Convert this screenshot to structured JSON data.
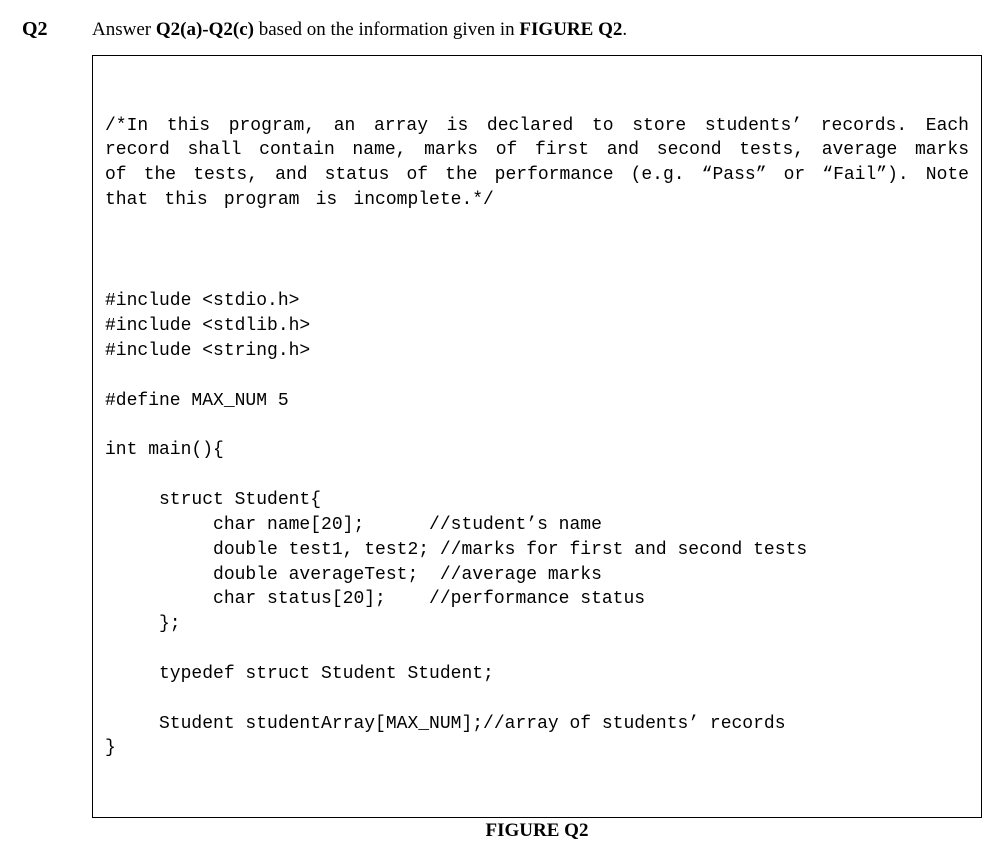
{
  "question": {
    "number": "Q2",
    "prompt_prefix": "Answer ",
    "prompt_bold1": "Q2(a)-Q2(c)",
    "prompt_mid": " based on the information given in  ",
    "prompt_bold2": "FIGURE Q2",
    "prompt_suffix": "."
  },
  "code": {
    "comment": "/*In this program, an array is declared to store students’ records. Each record shall contain name, marks of first and second tests, average marks of the tests, and status of the performance (e.g. “Pass” or “Fail”). Note that this program is incomplete.*/",
    "lines": [
      "",
      "#include <stdio.h>",
      "#include <stdlib.h>",
      "#include <string.h>",
      "",
      "#define MAX_NUM 5",
      "",
      "int main(){",
      "",
      "     struct Student{",
      "          char name[20];      //student’s name",
      "          double test1, test2; //marks for first and second tests",
      "          double averageTest;  //average marks",
      "          char status[20];    //performance status",
      "     };",
      "",
      "     typedef struct Student Student;",
      "",
      "     Student studentArray[MAX_NUM];//array of students’ records",
      "}"
    ]
  },
  "caption": "FIGURE Q2"
}
